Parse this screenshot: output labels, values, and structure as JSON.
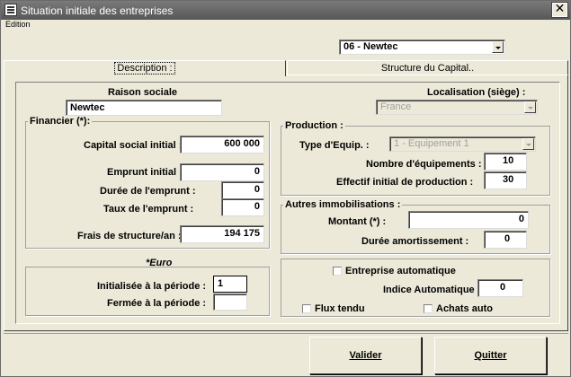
{
  "window": {
    "title": "Situation initiale des entreprises",
    "close": "✕"
  },
  "menu": {
    "edition": "Edition"
  },
  "company_select": {
    "value": "06 - Newtec"
  },
  "tabs": [
    {
      "label": "Description :"
    },
    {
      "label": "Structure du Capital.."
    }
  ],
  "raison": {
    "label": "Raison sociale",
    "value": "Newtec"
  },
  "localisation": {
    "label": "Localisation (siège) :",
    "value": "France"
  },
  "financier": {
    "legend": "Financier (*):",
    "capital_label": "Capital social initial :",
    "capital_value": "600 000",
    "emprunt_label": "Emprunt initial :",
    "emprunt_value": "0",
    "duree_label": "Durée de l'emprunt :",
    "duree_value": "0",
    "taux_label": "Taux de l'emprunt :",
    "taux_value": "0",
    "frais_label": "Frais de structure/an :",
    "frais_value": "194 175"
  },
  "euro_note": "*Euro",
  "periode": {
    "init_label": "Initialisée à la période :",
    "init_value": "1",
    "fermee_label": "Fermée à la période :",
    "fermee_value": ""
  },
  "production": {
    "legend": "Production :",
    "type_label": "Type d'Equip. :",
    "type_value": "1 - Equipement 1",
    "nb_label": "Nombre d'équipements :",
    "nb_value": "10",
    "effectif_label": "Effectif initial de production :",
    "effectif_value": "30"
  },
  "immobilisations": {
    "legend": "Autres immobilisations :",
    "montant_label": "Montant (*) :",
    "montant_value": "0",
    "duree_label": "Durée amortissement :",
    "duree_value": "0"
  },
  "auto": {
    "entreprise_label": "Entreprise automatique",
    "indice_label": "Indice Automatique",
    "indice_value": "0",
    "flux_label": "Flux tendu",
    "achats_label": "Achats auto"
  },
  "buttons": {
    "valider": "Valider",
    "quitter": "Quitter"
  }
}
